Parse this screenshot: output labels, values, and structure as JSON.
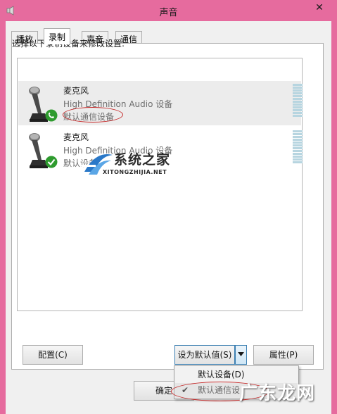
{
  "window": {
    "title": "声音",
    "close_glyph": "✕",
    "background_color": "#e66b9e"
  },
  "tabs": [
    {
      "label": "播放",
      "active": false
    },
    {
      "label": "录制",
      "active": true
    },
    {
      "label": "声音",
      "active": false
    },
    {
      "label": "通信",
      "active": false
    }
  ],
  "panel": {
    "instruction": "选择以下录制设备来修改设置:"
  },
  "devices": [
    {
      "name": "麦克风",
      "description": "High Definition Audio 设备",
      "status": "默认通信设备",
      "badge_icon": "phone-badge-icon",
      "badge_color": "#2e9b2e",
      "selected": true
    },
    {
      "name": "麦克风",
      "description": "High Definition Audio 设备",
      "status": "默认设备",
      "badge_icon": "check-badge-icon",
      "badge_color": "#2e9b2e",
      "selected": false
    }
  ],
  "watermark": {
    "text": "系统之家",
    "url": "XITONGZHIJIA.NET"
  },
  "buttons": {
    "configure": "配置(C)",
    "set_default": "设为默认值(S)",
    "properties": "属性(P)",
    "ok": "确定"
  },
  "set_default_menu": [
    {
      "label": "默认设备(D)",
      "checked": false
    },
    {
      "label": "默认通信设",
      "checked": true
    }
  ],
  "corner_watermark": "广东龙网",
  "highlight_color": "#c62a2a"
}
